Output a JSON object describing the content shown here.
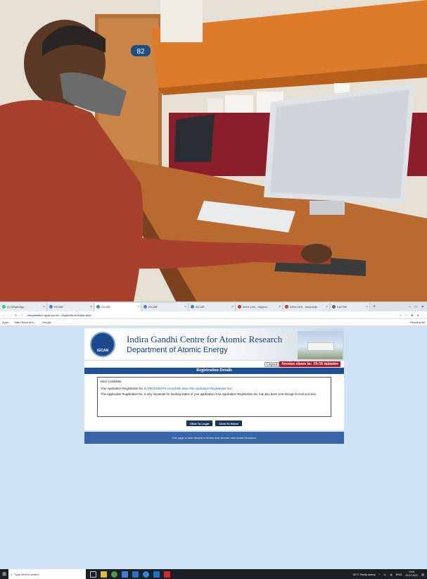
{
  "photo": {
    "door_number": "82"
  },
  "browser": {
    "tabs": [
      {
        "label": "(1) WhatsApp"
      },
      {
        "label": "IGCAR"
      },
      {
        "label": "IGCAR",
        "active": true
      },
      {
        "label": "IGCAR"
      },
      {
        "label": "IGCAR"
      },
      {
        "label": "Inbox (16) - mypmo..."
      },
      {
        "label": "Inbox (40) - resume@..."
      },
      {
        "label": "Iran Rei"
      }
    ],
    "url": "reregistration.igcar.gov.in/.../ApplicationDetails.aspx",
    "bookmarks": [
      "Apps",
      "State Bank of In...",
      "Google"
    ],
    "reading_list": "Reading list"
  },
  "page": {
    "logo_text": "IGCAR",
    "org_name": "Indira Gandhi Centre for Atomic Research",
    "dept_name": "Department of Atomic Energy",
    "logout_label": "Logout",
    "session_text": "Session closes in: 19:56 minutes",
    "section_title": "Registration Details",
    "greeting": "Dear Candidate,",
    "app_reg_prefix": "Your Application Registration No. is ",
    "app_reg_no": "(RE2018/0078 xxxx)(Note down this Application Registration No.)",
    "app_reg_note": "This Application Registration No. is very important for tracking status of your application.Your Application Registration No. has also been sent through E-mail and sms.",
    "login_button": "Click To Login",
    "home_button": "Click To Home",
    "footer_text": "This page is best viewed in firefox and chrome and recent browsers."
  },
  "taskbar": {
    "search_placeholder": "Type here to search",
    "weather": "32°C  Partly sunny",
    "lang": "ENG",
    "time": "13:01",
    "date": "23-07-2021"
  },
  "colors": {
    "page_bg": "#cfe3f7",
    "header_blue": "#1f4f96",
    "session_red": "#b5172a",
    "button_navy": "#1c3a66",
    "footer_blue": "#3a64a8"
  }
}
